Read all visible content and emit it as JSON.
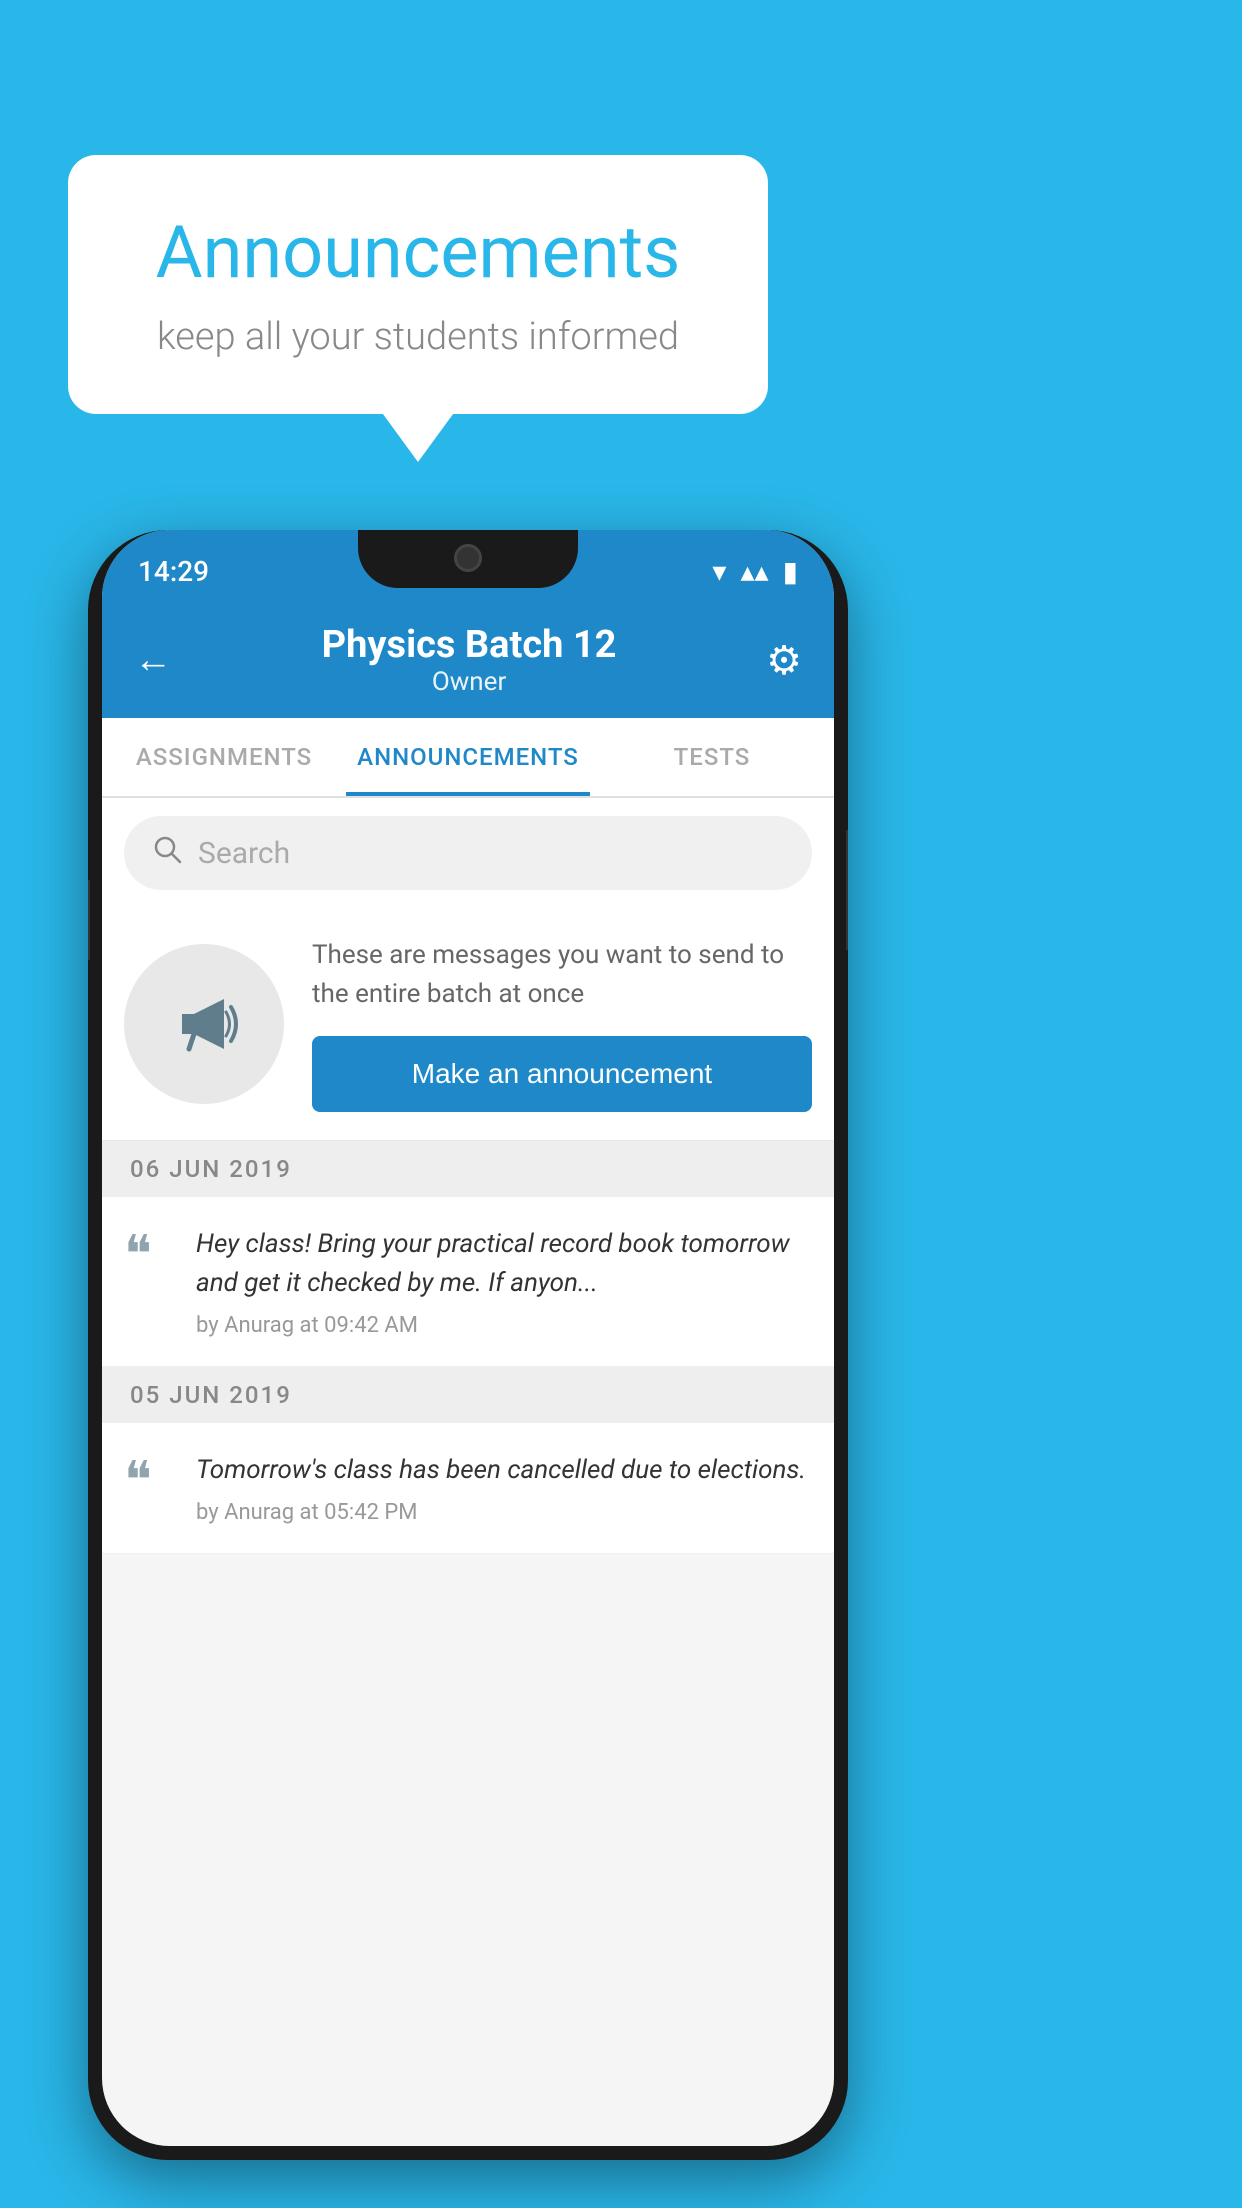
{
  "background_color": "#29b6e8",
  "speech_bubble": {
    "title": "Announcements",
    "subtitle": "keep all your students informed"
  },
  "phone": {
    "status_bar": {
      "time": "14:29",
      "wifi": "▼",
      "signal": "▲",
      "battery": "▮"
    },
    "header": {
      "title": "Physics Batch 12",
      "subtitle": "Owner",
      "back_label": "←",
      "gear_label": "⚙"
    },
    "tabs": [
      {
        "label": "ASSIGNMENTS",
        "active": false
      },
      {
        "label": "ANNOUNCEMENTS",
        "active": true
      },
      {
        "label": "TESTS",
        "active": false
      }
    ],
    "search": {
      "placeholder": "Search"
    },
    "empty_state": {
      "description": "These are messages you want to send to the entire batch at once",
      "button_label": "Make an announcement"
    },
    "announcements": [
      {
        "date": "06  JUN  2019",
        "text": "Hey class! Bring your practical record book tomorrow and get it checked by me. If anyon...",
        "meta": "by Anurag at 09:42 AM"
      },
      {
        "date": "05  JUN  2019",
        "text": "Tomorrow's class has been cancelled due to elections.",
        "meta": "by Anurag at 05:42 PM"
      }
    ]
  }
}
